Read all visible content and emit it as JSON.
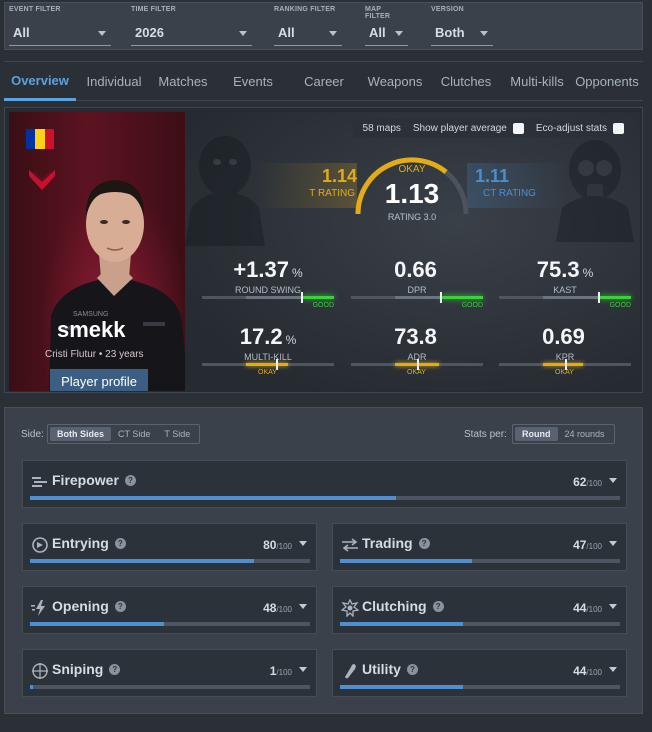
{
  "filters": [
    {
      "label": "EVENT FILTER",
      "value": "All"
    },
    {
      "label": "TIME FILTER",
      "value": "2026"
    },
    {
      "label": "RANKING FILTER",
      "value": "All"
    },
    {
      "label": "MAP FILTER",
      "value": "All"
    },
    {
      "label": "VERSION",
      "value": "Both"
    }
  ],
  "tabs": [
    "Overview",
    "Individual",
    "Matches",
    "Events",
    "Career",
    "Weapons",
    "Clutches",
    "Multi-kills",
    "Opponents"
  ],
  "active_tab": "Overview",
  "player": {
    "nickname": "smekk",
    "meta": "Cristi Flutur • 23 years",
    "profile_button": "Player profile",
    "flag_colors": [
      "#0033a0",
      "#fcd116",
      "#ce1126"
    ],
    "team_logo_color": "#c8102e"
  },
  "toggles": {
    "maps": "58 maps",
    "show_average": "Show player average",
    "eco_adjust": "Eco-adjust stats"
  },
  "ratings": {
    "t_value": "1.14",
    "t_label": "T RATING",
    "main_value": "1.13",
    "main_label": "RATING 3.0",
    "main_grade": "OKAY",
    "ct_value": "1.11",
    "ct_label": "CT RATING"
  },
  "stats": [
    {
      "value": "+1.37",
      "unit": "%",
      "label": "ROUND SWING",
      "grade": "GOOD"
    },
    {
      "value": "0.66",
      "unit": "",
      "label": "DPR",
      "grade": "GOOD"
    },
    {
      "value": "75.3",
      "unit": "%",
      "label": "KAST",
      "grade": "GOOD"
    },
    {
      "value": "17.2",
      "unit": "%",
      "label": "MULTI-KILL",
      "grade": "OKAY"
    },
    {
      "value": "73.8",
      "unit": "",
      "label": "ADR",
      "grade": "OKAY"
    },
    {
      "value": "0.69",
      "unit": "",
      "label": "KPR",
      "grade": "OKAY"
    }
  ],
  "colors": {
    "accent": "#5aa2e0",
    "good": "#3bd13b",
    "okay": "#e3ac17",
    "t_side": "#e3ac17",
    "ct_side": "#4a8fd0",
    "bar_fill": "#4f8fd0"
  },
  "side_filter": {
    "label": "Side:",
    "options": [
      "Both Sides",
      "CT Side",
      "T Side"
    ],
    "selected": "Both Sides"
  },
  "stats_per": {
    "label": "Stats per:",
    "options": [
      "Round",
      "24 rounds"
    ],
    "selected": "Round"
  },
  "categories": [
    {
      "name": "Firepower",
      "score": "62",
      "max": "/100",
      "icon": "firepower-icon",
      "fill": 0.62
    },
    {
      "name": "Entrying",
      "score": "80",
      "max": "/100",
      "icon": "entrying-icon",
      "fill": 0.8
    },
    {
      "name": "Trading",
      "score": "47",
      "max": "/100",
      "icon": "trading-icon",
      "fill": 0.47
    },
    {
      "name": "Opening",
      "score": "48",
      "max": "/100",
      "icon": "opening-icon",
      "fill": 0.48
    },
    {
      "name": "Clutching",
      "score": "44",
      "max": "/100",
      "icon": "clutching-icon",
      "fill": 0.44
    },
    {
      "name": "Sniping",
      "score": "1",
      "max": "/100",
      "icon": "sniping-icon",
      "fill": 0.01
    },
    {
      "name": "Utility",
      "score": "44",
      "max": "/100",
      "icon": "utility-icon",
      "fill": 0.44
    }
  ]
}
